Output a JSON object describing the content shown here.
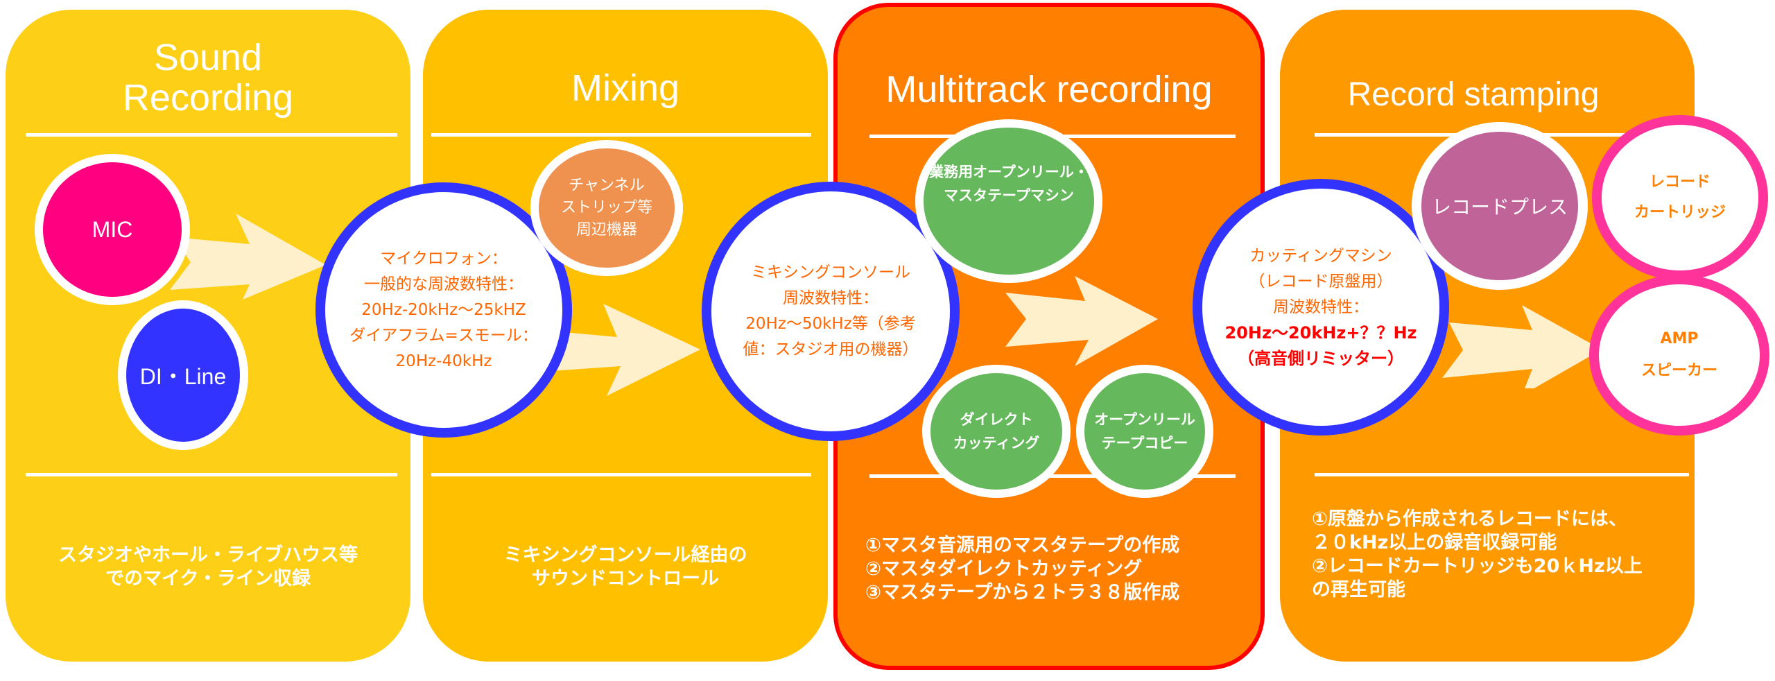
{
  "colors": {
    "panel_sound": "#fdd017",
    "panel_mixing": "#ffc000",
    "panel_multitrack": "#ff8000",
    "panel_multitrack_border": "#ff0000",
    "panel_stamping": "#ff9900",
    "mic": "#ff0080",
    "di_line": "#3333ff",
    "spec_circle_border": "#3333ff",
    "spec_text": "#ff6600",
    "spec_highlight": "#ff0000",
    "channel_strip": "#f0924f",
    "tape_machine": "#66b85c",
    "record_press": "#bf6398",
    "output_border": "#ff3399",
    "arrow": "#fff0cc"
  },
  "panels": [
    {
      "title_lines": [
        "Sound",
        "Recording"
      ],
      "description_lines": [
        "スタジオやホール・ライブハウス等",
        "でのマイク・ライン収録"
      ]
    },
    {
      "title_lines": [
        "Mixing"
      ],
      "description_lines": [
        "ミキシングコンソール経由の",
        "サウンドコントロール"
      ]
    },
    {
      "title_lines": [
        "Multitrack recording"
      ],
      "description_lines": [
        "①マスタ音源用のマスタテープの作成",
        "②マスタダイレクトカッティング",
        "③マスタテープから２トラ３８版作成"
      ]
    },
    {
      "title_lines": [
        "Record stamping"
      ],
      "description_lines": [
        "①原盤から作成されるレコードには、",
        "２０kHz以上の録音収録可能",
        "②レコードカートリッジも20ｋHz以上",
        "の再生可能"
      ]
    }
  ],
  "nodes": {
    "mic": {
      "label": "MIC"
    },
    "di_line": {
      "label": "DI・Line"
    },
    "microphone_spec": {
      "lines": [
        "マイクロフォン：",
        "一般的な周波数特性：",
        "20Hz-20kHz～25kHZ",
        "ダイアフラム=スモール：",
        "20Hz-40kHz"
      ]
    },
    "channel_strip": {
      "lines": [
        "チャンネル",
        "ストリップ等",
        "周辺機器"
      ]
    },
    "console_spec": {
      "lines": [
        "ミキシングコンソール",
        "周波数特性：",
        "20Hz～50kHz等（参考",
        "値：スタジオ用の機器）"
      ]
    },
    "tape_machine": {
      "lines": [
        "業務用オープンリール・",
        "マスタテープマシン"
      ]
    },
    "direct_cutting": {
      "lines": [
        "ダイレクト",
        "カッティング"
      ]
    },
    "reel_copy": {
      "lines": [
        "オープンリール",
        "テープコピー"
      ]
    },
    "cutting_machine": {
      "lines": [
        "カッティングマシン",
        "（レコード原盤用）",
        "周波数特性："
      ],
      "highlight_lines": [
        "20Hz～20kHz+？？Hz",
        "（高音側リミッター）"
      ]
    },
    "record_press": {
      "label": "レコードプレス"
    },
    "cartridge": {
      "lines": [
        "レコード",
        "カートリッジ"
      ]
    },
    "amp_speaker": {
      "lines": [
        "AMP",
        "スピーカー"
      ]
    }
  },
  "icons": {
    "flow_arrow": "right-arrow"
  }
}
